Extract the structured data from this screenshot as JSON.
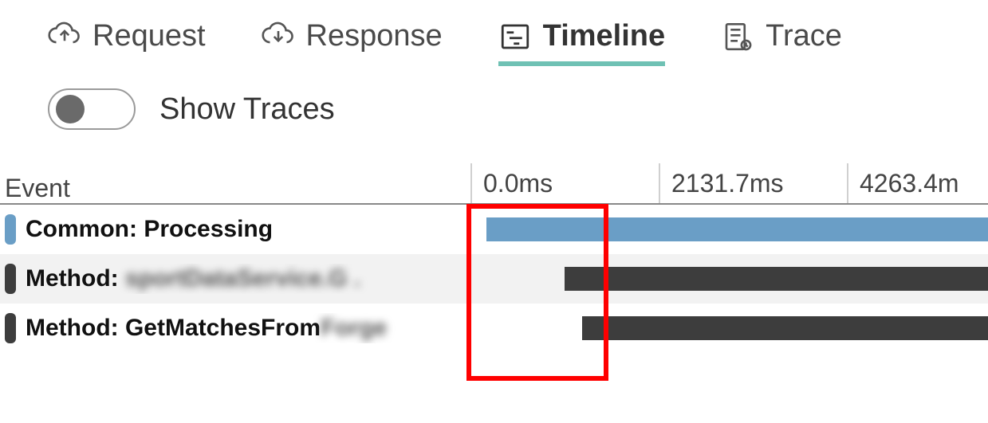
{
  "tabs": {
    "request": "Request",
    "response": "Response",
    "timeline": "Timeline",
    "trace": "Trace"
  },
  "toggle": {
    "label": "Show Traces"
  },
  "header": {
    "event": "Event",
    "t0": "0.0ms",
    "t1": "2131.7ms",
    "t2": "4263.4m"
  },
  "rows": {
    "r0": {
      "label": "Common: Processing"
    },
    "r1": {
      "prefix": "Method: ",
      "blur": "sportDataService.G ."
    },
    "r2": {
      "prefix": "Method: GetMatchesFrom",
      "blur": "Forge"
    }
  }
}
